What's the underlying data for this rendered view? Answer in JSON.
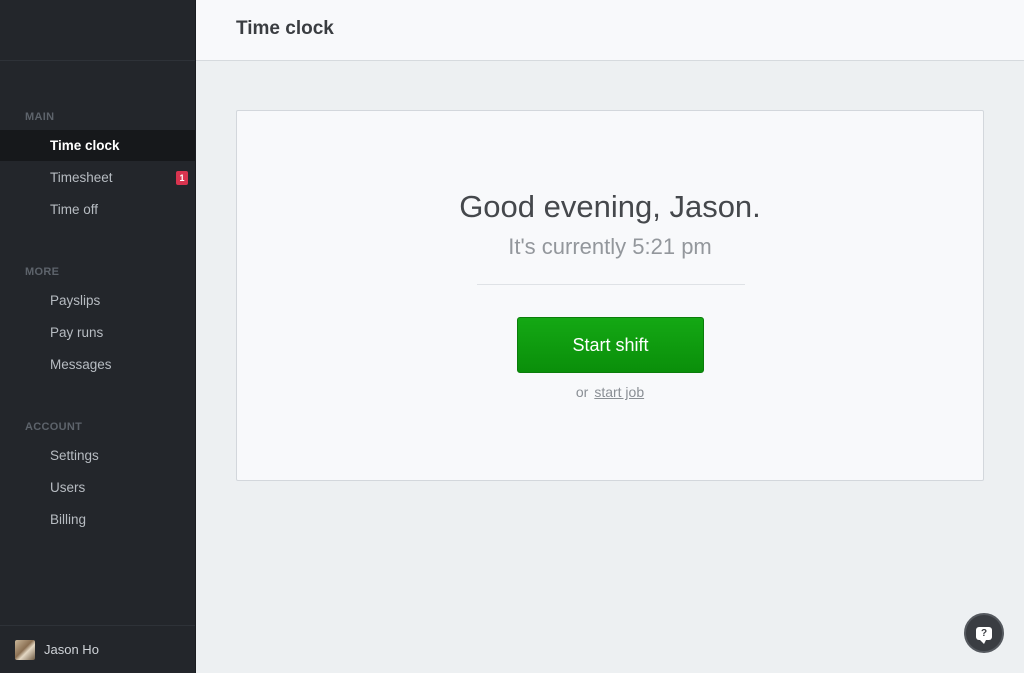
{
  "sidebar": {
    "sections": [
      {
        "label": "MAIN",
        "items": [
          {
            "label": "Time clock",
            "active": true
          },
          {
            "label": "Timesheet",
            "badge": "1"
          },
          {
            "label": "Time off"
          }
        ]
      },
      {
        "label": "MORE",
        "items": [
          {
            "label": "Payslips"
          },
          {
            "label": "Pay runs"
          },
          {
            "label": "Messages"
          }
        ]
      },
      {
        "label": "ACCOUNT",
        "items": [
          {
            "label": "Settings"
          },
          {
            "label": "Users"
          },
          {
            "label": "Billing"
          }
        ]
      }
    ],
    "user": {
      "name": "Jason Ho"
    }
  },
  "header": {
    "title": "Time clock"
  },
  "main": {
    "greeting": "Good evening, Jason.",
    "current_time": "It's currently 5:21 pm",
    "start_shift_label": "Start shift",
    "or_text": "or",
    "start_job_label": "start job"
  },
  "colors": {
    "accent_green": "#0a9c0a",
    "badge_red": "#d8344f",
    "sidebar_bg": "#23262b"
  },
  "help_icon": "help-chat-icon"
}
